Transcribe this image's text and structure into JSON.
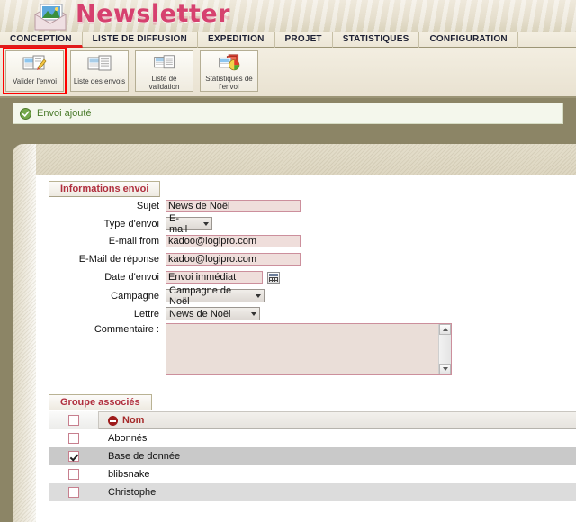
{
  "app": {
    "title": "Newsletter",
    "logo_icon": "envelope-picture-icon"
  },
  "menu": {
    "items": [
      {
        "label": "CONCEPTION",
        "active": true
      },
      {
        "label": "LISTE DE DIFFUSION",
        "active": false
      },
      {
        "label": "EXPEDITION",
        "active": false
      },
      {
        "label": "PROJET",
        "active": false
      },
      {
        "label": "STATISTIQUES",
        "active": false
      },
      {
        "label": "CONFIGURATION",
        "active": false
      }
    ]
  },
  "toolbar": {
    "buttons": [
      {
        "label": "Valider l'envoi",
        "icon": "validate-send-icon",
        "selected": true
      },
      {
        "label": "Liste des envois",
        "icon": "list-sends-icon",
        "selected": false
      },
      {
        "label": "Liste de validation",
        "icon": "list-validation-icon",
        "selected": false
      },
      {
        "label": "Statistiques de l'envoi",
        "icon": "statistics-pie-icon",
        "selected": false
      }
    ]
  },
  "notice": {
    "icon": "success-check-icon",
    "text": "Envoi ajouté",
    "color": "#4a7a2a"
  },
  "panels": {
    "info": {
      "title": "Informations envoi",
      "fields": {
        "sujet": {
          "label": "Sujet",
          "value": "News de Noël"
        },
        "type_envoi": {
          "label": "Type d'envoi",
          "value": "E-mail"
        },
        "email_from": {
          "label": "E-mail from",
          "value": "kadoo@logipro.com"
        },
        "email_reponse": {
          "label": "E-Mail de réponse",
          "value": "kadoo@logipro.com"
        },
        "date_envoi": {
          "label": "Date d'envoi",
          "value": "Envoi immédiat",
          "button_icon": "calendar-icon"
        },
        "campagne": {
          "label": "Campagne",
          "value": "Campagne de Noël"
        },
        "lettre": {
          "label": "Lettre",
          "value": "News de Noël"
        },
        "commentaire": {
          "label": "Commentaire :",
          "value": ""
        }
      }
    },
    "groups": {
      "title": "Groupe associés",
      "header": {
        "select_all_checked": false,
        "name_label": "Nom",
        "name_icon": "collapse-minus-icon"
      },
      "rows": [
        {
          "checked": false,
          "name": "Abonnés",
          "shade": "rowA"
        },
        {
          "checked": true,
          "name": "Base de donnée",
          "shade": "rowB"
        },
        {
          "checked": false,
          "name": "blibsnake",
          "shade": "rowA"
        },
        {
          "checked": false,
          "name": "Christophe",
          "shade": "rowC"
        }
      ]
    }
  },
  "colors": {
    "brand_pink": "#d6416f",
    "panel_title": "#b02f3e",
    "input_bg": "#efdedb",
    "input_border": "#cc8f9c",
    "page_bg": "#8c8566",
    "menu_active_underline": "#e01b1b"
  }
}
